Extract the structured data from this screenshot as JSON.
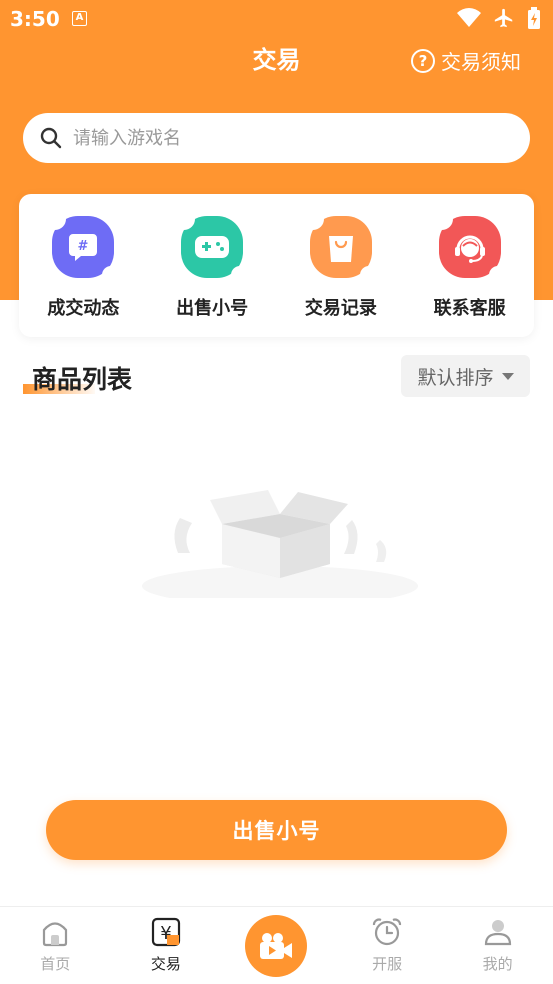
{
  "status_bar": {
    "time": "3:50",
    "a_badge": "A"
  },
  "header": {
    "title": "交易",
    "notice_label": "交易须知",
    "notice_icon": "?"
  },
  "search": {
    "placeholder": "请输入游戏名",
    "value": ""
  },
  "quick_actions": [
    {
      "label": "成交动态",
      "icon": "hash-chat-icon",
      "color": "#6E6CF5",
      "glyph": "#"
    },
    {
      "label": "出售小号",
      "icon": "gamepad-icon",
      "color": "#2CC7A6",
      "glyph": ""
    },
    {
      "label": "交易记录",
      "icon": "shopping-bag-icon",
      "color": "#FF9A4F",
      "glyph": ""
    },
    {
      "label": "联系客服",
      "icon": "headset-icon",
      "color": "#F25757",
      "glyph": ""
    }
  ],
  "product_list": {
    "title": "商品列表",
    "sort_label": "默认排序"
  },
  "sell_button": {
    "label": "出售小号"
  },
  "tabbar": {
    "items": [
      {
        "label": "首页",
        "icon": "home-icon",
        "active": false
      },
      {
        "label": "交易",
        "icon": "yen-icon",
        "active": true,
        "glyph": "¥"
      },
      {
        "label": "",
        "icon": "video-camera-icon",
        "active": false
      },
      {
        "label": "开服",
        "icon": "alarm-clock-icon",
        "active": false
      },
      {
        "label": "我的",
        "icon": "user-icon",
        "active": false
      }
    ]
  },
  "colors": {
    "accent": "#FF9530",
    "text": "#222222",
    "muted": "#AAAAAA"
  }
}
